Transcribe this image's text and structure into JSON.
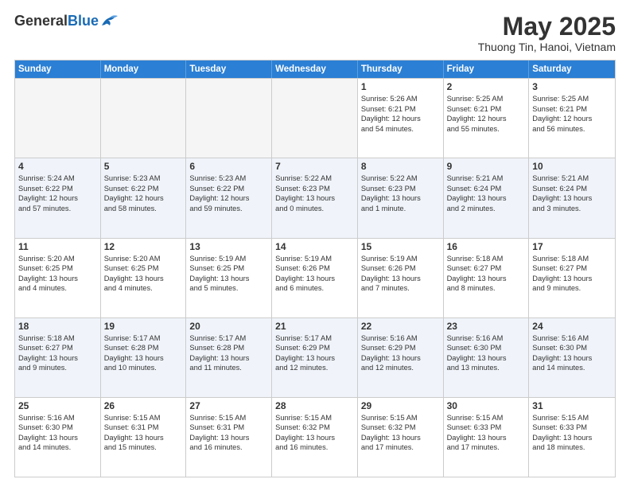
{
  "logo": {
    "general": "General",
    "blue": "Blue"
  },
  "title": "May 2025",
  "subtitle": "Thuong Tin, Hanoi, Vietnam",
  "weekdays": [
    "Sunday",
    "Monday",
    "Tuesday",
    "Wednesday",
    "Thursday",
    "Friday",
    "Saturday"
  ],
  "weeks": [
    [
      {
        "day": "",
        "lines": [],
        "empty": true
      },
      {
        "day": "",
        "lines": [],
        "empty": true
      },
      {
        "day": "",
        "lines": [],
        "empty": true
      },
      {
        "day": "",
        "lines": [],
        "empty": true
      },
      {
        "day": "1",
        "lines": [
          "Sunrise: 5:26 AM",
          "Sunset: 6:21 PM",
          "Daylight: 12 hours",
          "and 54 minutes."
        ],
        "empty": false
      },
      {
        "day": "2",
        "lines": [
          "Sunrise: 5:25 AM",
          "Sunset: 6:21 PM",
          "Daylight: 12 hours",
          "and 55 minutes."
        ],
        "empty": false
      },
      {
        "day": "3",
        "lines": [
          "Sunrise: 5:25 AM",
          "Sunset: 6:21 PM",
          "Daylight: 12 hours",
          "and 56 minutes."
        ],
        "empty": false
      }
    ],
    [
      {
        "day": "4",
        "lines": [
          "Sunrise: 5:24 AM",
          "Sunset: 6:22 PM",
          "Daylight: 12 hours",
          "and 57 minutes."
        ],
        "empty": false
      },
      {
        "day": "5",
        "lines": [
          "Sunrise: 5:23 AM",
          "Sunset: 6:22 PM",
          "Daylight: 12 hours",
          "and 58 minutes."
        ],
        "empty": false
      },
      {
        "day": "6",
        "lines": [
          "Sunrise: 5:23 AM",
          "Sunset: 6:22 PM",
          "Daylight: 12 hours",
          "and 59 minutes."
        ],
        "empty": false
      },
      {
        "day": "7",
        "lines": [
          "Sunrise: 5:22 AM",
          "Sunset: 6:23 PM",
          "Daylight: 13 hours",
          "and 0 minutes."
        ],
        "empty": false
      },
      {
        "day": "8",
        "lines": [
          "Sunrise: 5:22 AM",
          "Sunset: 6:23 PM",
          "Daylight: 13 hours",
          "and 1 minute."
        ],
        "empty": false
      },
      {
        "day": "9",
        "lines": [
          "Sunrise: 5:21 AM",
          "Sunset: 6:24 PM",
          "Daylight: 13 hours",
          "and 2 minutes."
        ],
        "empty": false
      },
      {
        "day": "10",
        "lines": [
          "Sunrise: 5:21 AM",
          "Sunset: 6:24 PM",
          "Daylight: 13 hours",
          "and 3 minutes."
        ],
        "empty": false
      }
    ],
    [
      {
        "day": "11",
        "lines": [
          "Sunrise: 5:20 AM",
          "Sunset: 6:25 PM",
          "Daylight: 13 hours",
          "and 4 minutes."
        ],
        "empty": false
      },
      {
        "day": "12",
        "lines": [
          "Sunrise: 5:20 AM",
          "Sunset: 6:25 PM",
          "Daylight: 13 hours",
          "and 4 minutes."
        ],
        "empty": false
      },
      {
        "day": "13",
        "lines": [
          "Sunrise: 5:19 AM",
          "Sunset: 6:25 PM",
          "Daylight: 13 hours",
          "and 5 minutes."
        ],
        "empty": false
      },
      {
        "day": "14",
        "lines": [
          "Sunrise: 5:19 AM",
          "Sunset: 6:26 PM",
          "Daylight: 13 hours",
          "and 6 minutes."
        ],
        "empty": false
      },
      {
        "day": "15",
        "lines": [
          "Sunrise: 5:19 AM",
          "Sunset: 6:26 PM",
          "Daylight: 13 hours",
          "and 7 minutes."
        ],
        "empty": false
      },
      {
        "day": "16",
        "lines": [
          "Sunrise: 5:18 AM",
          "Sunset: 6:27 PM",
          "Daylight: 13 hours",
          "and 8 minutes."
        ],
        "empty": false
      },
      {
        "day": "17",
        "lines": [
          "Sunrise: 5:18 AM",
          "Sunset: 6:27 PM",
          "Daylight: 13 hours",
          "and 9 minutes."
        ],
        "empty": false
      }
    ],
    [
      {
        "day": "18",
        "lines": [
          "Sunrise: 5:18 AM",
          "Sunset: 6:27 PM",
          "Daylight: 13 hours",
          "and 9 minutes."
        ],
        "empty": false
      },
      {
        "day": "19",
        "lines": [
          "Sunrise: 5:17 AM",
          "Sunset: 6:28 PM",
          "Daylight: 13 hours",
          "and 10 minutes."
        ],
        "empty": false
      },
      {
        "day": "20",
        "lines": [
          "Sunrise: 5:17 AM",
          "Sunset: 6:28 PM",
          "Daylight: 13 hours",
          "and 11 minutes."
        ],
        "empty": false
      },
      {
        "day": "21",
        "lines": [
          "Sunrise: 5:17 AM",
          "Sunset: 6:29 PM",
          "Daylight: 13 hours",
          "and 12 minutes."
        ],
        "empty": false
      },
      {
        "day": "22",
        "lines": [
          "Sunrise: 5:16 AM",
          "Sunset: 6:29 PM",
          "Daylight: 13 hours",
          "and 12 minutes."
        ],
        "empty": false
      },
      {
        "day": "23",
        "lines": [
          "Sunrise: 5:16 AM",
          "Sunset: 6:30 PM",
          "Daylight: 13 hours",
          "and 13 minutes."
        ],
        "empty": false
      },
      {
        "day": "24",
        "lines": [
          "Sunrise: 5:16 AM",
          "Sunset: 6:30 PM",
          "Daylight: 13 hours",
          "and 14 minutes."
        ],
        "empty": false
      }
    ],
    [
      {
        "day": "25",
        "lines": [
          "Sunrise: 5:16 AM",
          "Sunset: 6:30 PM",
          "Daylight: 13 hours",
          "and 14 minutes."
        ],
        "empty": false
      },
      {
        "day": "26",
        "lines": [
          "Sunrise: 5:15 AM",
          "Sunset: 6:31 PM",
          "Daylight: 13 hours",
          "and 15 minutes."
        ],
        "empty": false
      },
      {
        "day": "27",
        "lines": [
          "Sunrise: 5:15 AM",
          "Sunset: 6:31 PM",
          "Daylight: 13 hours",
          "and 16 minutes."
        ],
        "empty": false
      },
      {
        "day": "28",
        "lines": [
          "Sunrise: 5:15 AM",
          "Sunset: 6:32 PM",
          "Daylight: 13 hours",
          "and 16 minutes."
        ],
        "empty": false
      },
      {
        "day": "29",
        "lines": [
          "Sunrise: 5:15 AM",
          "Sunset: 6:32 PM",
          "Daylight: 13 hours",
          "and 17 minutes."
        ],
        "empty": false
      },
      {
        "day": "30",
        "lines": [
          "Sunrise: 5:15 AM",
          "Sunset: 6:33 PM",
          "Daylight: 13 hours",
          "and 17 minutes."
        ],
        "empty": false
      },
      {
        "day": "31",
        "lines": [
          "Sunrise: 5:15 AM",
          "Sunset: 6:33 PM",
          "Daylight: 13 hours",
          "and 18 minutes."
        ],
        "empty": false
      }
    ]
  ]
}
